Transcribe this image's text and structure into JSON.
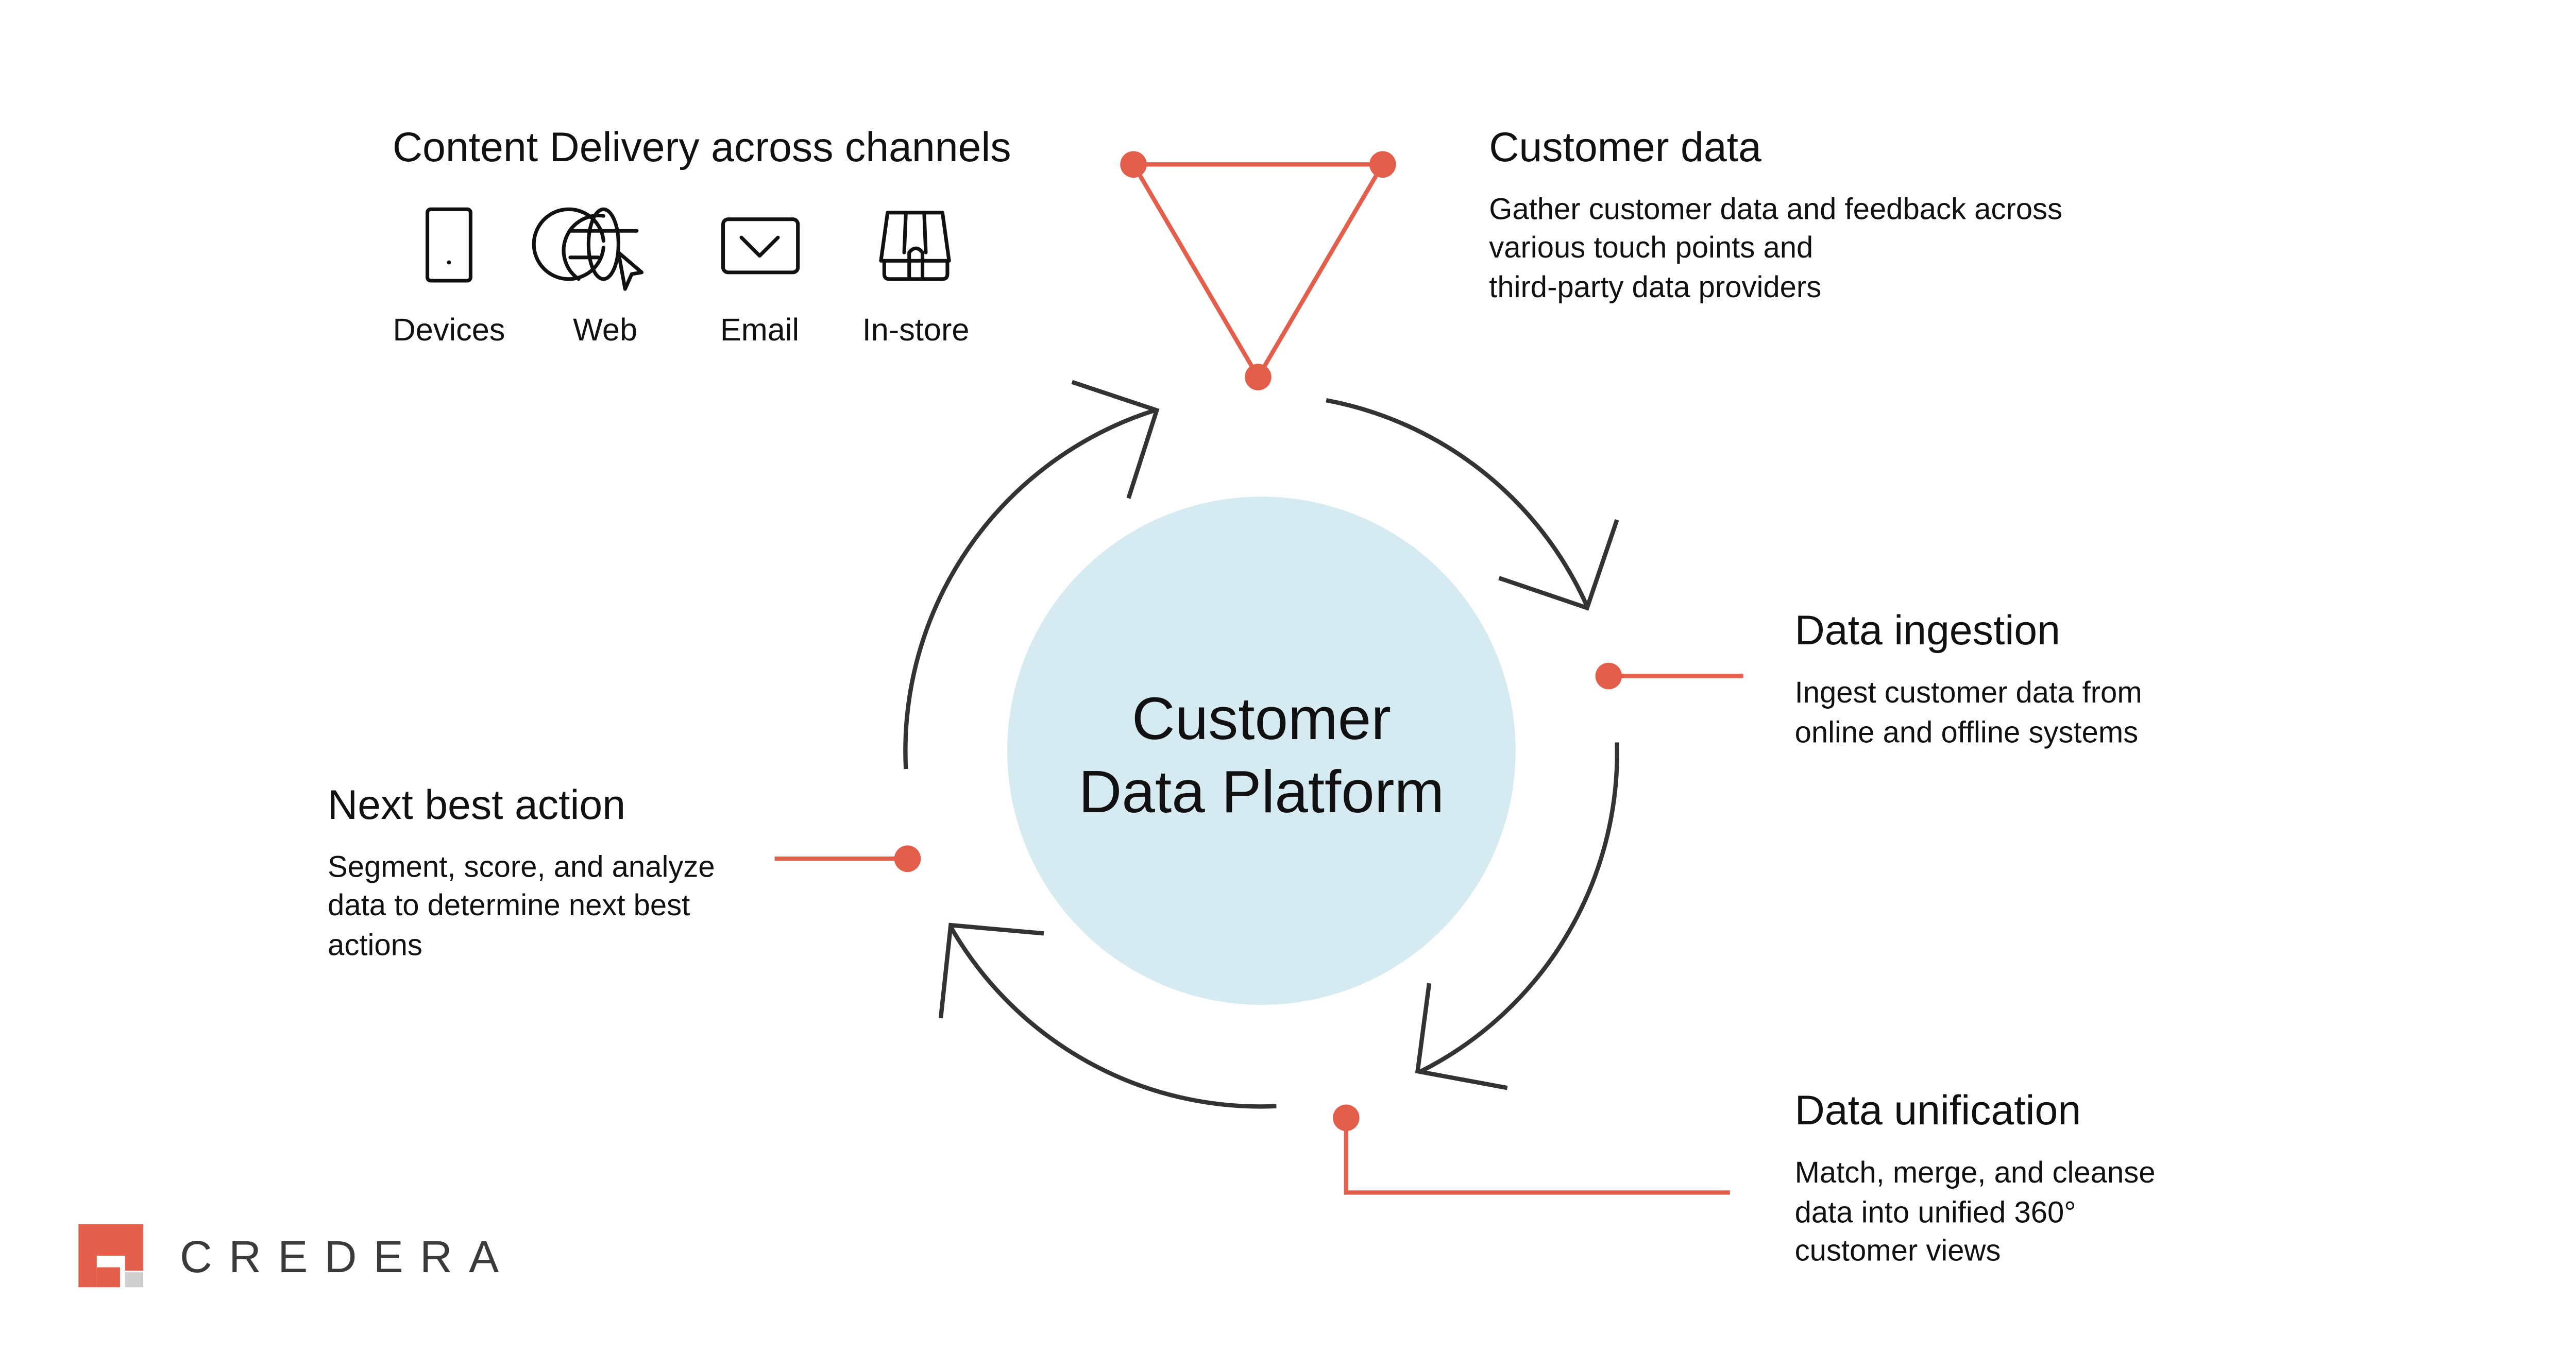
{
  "colors": {
    "accent": "#E45F4B",
    "platform_fill": "#D6EBF1",
    "arrow": "#333333",
    "logo_gray": "#CFCFCF"
  },
  "center": {
    "line1": "Customer",
    "line2": "Data Platform"
  },
  "channels": {
    "title": "Content Delivery across channels",
    "items": [
      {
        "label": "Devices",
        "icon": "mobile-device-icon"
      },
      {
        "label": "Web",
        "icon": "globe-cursor-icon"
      },
      {
        "label": "Email",
        "icon": "envelope-icon"
      },
      {
        "label": "In-store",
        "icon": "storefront-icon"
      }
    ]
  },
  "steps": {
    "customer_data": {
      "title": "Customer data",
      "lines": [
        "Gather customer data and feedback across",
        "various touch points and",
        "third-party data providers"
      ]
    },
    "ingestion": {
      "title": "Data ingestion",
      "lines": [
        "Ingest customer data from",
        "online and offline systems"
      ]
    },
    "unification": {
      "title": "Data unification",
      "lines": [
        "Match, merge, and cleanse",
        "data into unified 360°",
        "customer views"
      ]
    },
    "next_best": {
      "title": "Next best action",
      "lines": [
        "Segment, score, and analyze",
        "data to determine next best",
        "actions"
      ]
    }
  },
  "logo": {
    "text": "CREDERA"
  }
}
